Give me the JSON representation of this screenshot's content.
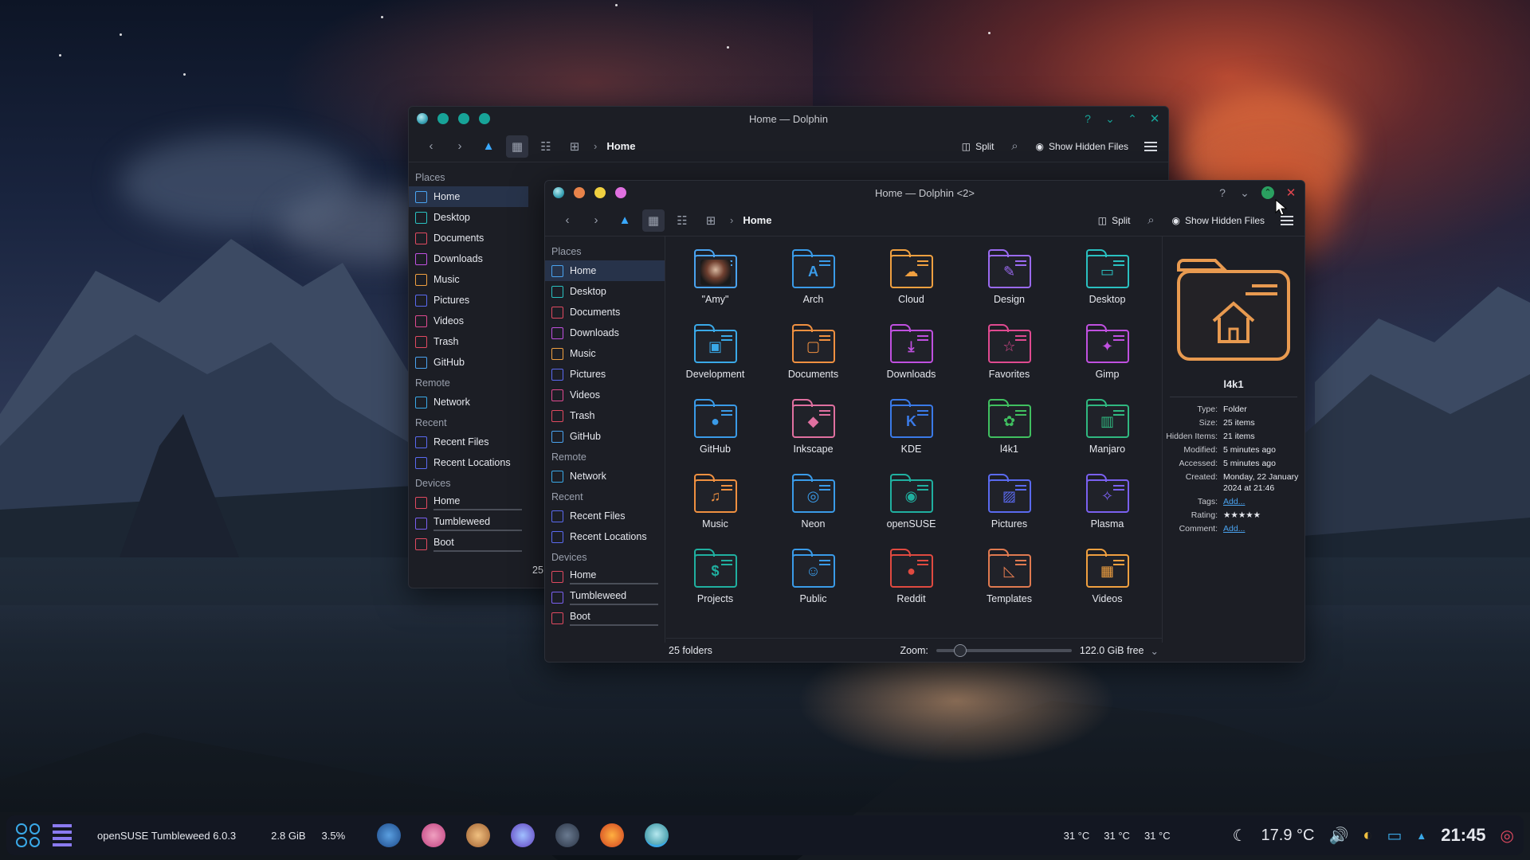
{
  "wallpaper": {
    "accent_sky": "#c94d37",
    "accent_water": "#e6aa78"
  },
  "window_back": {
    "title": "Home — Dolphin",
    "toolbar": {
      "breadcrumb": "Home",
      "split_label": "Split",
      "hidden_files_label": "Show Hidden Files"
    },
    "sidebar": {
      "places_header": "Places",
      "places": [
        "Home",
        "Desktop",
        "Documents",
        "Downloads",
        "Music",
        "Pictures",
        "Videos",
        "Trash",
        "GitHub"
      ],
      "remote_header": "Remote",
      "remote": [
        "Network"
      ],
      "recent_header": "Recent",
      "recent": [
        "Recent Files",
        "Recent Locations"
      ],
      "devices_header": "Devices",
      "devices": [
        "Home",
        "Tumbleweed",
        "Boot"
      ]
    },
    "status_partial": "25"
  },
  "window_front": {
    "title": "Home — Dolphin <2>",
    "toolbar": {
      "breadcrumb": "Home",
      "split_label": "Split",
      "hidden_files_label": "Show Hidden Files"
    },
    "sidebar": {
      "places_header": "Places",
      "places": [
        "Home",
        "Desktop",
        "Documents",
        "Downloads",
        "Music",
        "Pictures",
        "Videos",
        "Trash",
        "GitHub"
      ],
      "remote_header": "Remote",
      "remote": [
        "Network"
      ],
      "recent_header": "Recent",
      "recent": [
        "Recent Files",
        "Recent Locations"
      ],
      "devices_header": "Devices",
      "devices": [
        "Home",
        "Tumbleweed",
        "Boot"
      ]
    },
    "folders": [
      {
        "name": "\"Amy\"",
        "color": "#4aa3f0",
        "glyph": ""
      },
      {
        "name": "Arch",
        "color": "#3a9be8",
        "glyph": "A"
      },
      {
        "name": "Cloud",
        "color": "#f0a040",
        "glyph": "☁"
      },
      {
        "name": "Design",
        "color": "#9a6af0",
        "glyph": "✎"
      },
      {
        "name": "Desktop",
        "color": "#2ac0c0",
        "glyph": "▭"
      },
      {
        "name": "Development",
        "color": "#3aa9e8",
        "glyph": "▣"
      },
      {
        "name": "Documents",
        "color": "#f09040",
        "glyph": "▢"
      },
      {
        "name": "Downloads",
        "color": "#c050e0",
        "glyph": "⤓"
      },
      {
        "name": "Favorites",
        "color": "#e04a90",
        "glyph": "☆"
      },
      {
        "name": "Gimp",
        "color": "#c050e0",
        "glyph": "✦"
      },
      {
        "name": "GitHub",
        "color": "#3a9be8",
        "glyph": "●"
      },
      {
        "name": "Inkscape",
        "color": "#e070a0",
        "glyph": "◆"
      },
      {
        "name": "KDE",
        "color": "#3a7ae8",
        "glyph": "K"
      },
      {
        "name": "l4k1",
        "color": "#40c060",
        "glyph": "✿"
      },
      {
        "name": "Manjaro",
        "color": "#30b880",
        "glyph": "▥"
      },
      {
        "name": "Music",
        "color": "#f09040",
        "glyph": "♫"
      },
      {
        "name": "Neon",
        "color": "#3a9be8",
        "glyph": "◎"
      },
      {
        "name": "openSUSE",
        "color": "#20b0a0",
        "glyph": "◉"
      },
      {
        "name": "Pictures",
        "color": "#5a6af0",
        "glyph": "▨"
      },
      {
        "name": "Plasma",
        "color": "#7a60f0",
        "glyph": "✧"
      },
      {
        "name": "Projects",
        "color": "#20b0a0",
        "glyph": "$"
      },
      {
        "name": "Public",
        "color": "#3a9be8",
        "glyph": "☺"
      },
      {
        "name": "Reddit",
        "color": "#e04a40",
        "glyph": "●"
      },
      {
        "name": "Templates",
        "color": "#e07a50",
        "glyph": "◺"
      },
      {
        "name": "Videos",
        "color": "#f0a040",
        "glyph": "▦"
      }
    ],
    "info": {
      "name": "l4k1",
      "fields": [
        {
          "k": "Type:",
          "v": "Folder"
        },
        {
          "k": "Size:",
          "v": "25 items"
        },
        {
          "k": "Hidden Items:",
          "v": "21 items"
        },
        {
          "k": "Modified:",
          "v": "5 minutes ago"
        },
        {
          "k": "Accessed:",
          "v": "5 minutes ago"
        },
        {
          "k": "Created:",
          "v": "Monday, 22 January 2024 at 21:46"
        },
        {
          "k": "Tags:",
          "v": "Add...",
          "link": true
        },
        {
          "k": "Rating:",
          "v": "★★★★★"
        },
        {
          "k": "Comment:",
          "v": "Add...",
          "link": true
        }
      ]
    },
    "status": {
      "count": "25 folders",
      "zoom_label": "Zoom:",
      "free": "122.0 GiB free"
    }
  },
  "taskbar": {
    "os_label": "openSUSE Tumbleweed 6.0.3",
    "mem": "2.8 GiB",
    "cpu": "3.5%",
    "temps": [
      "31 °C",
      "31 °C",
      "31 °C"
    ],
    "weather": "17.9 °C",
    "clock": "21:45"
  }
}
